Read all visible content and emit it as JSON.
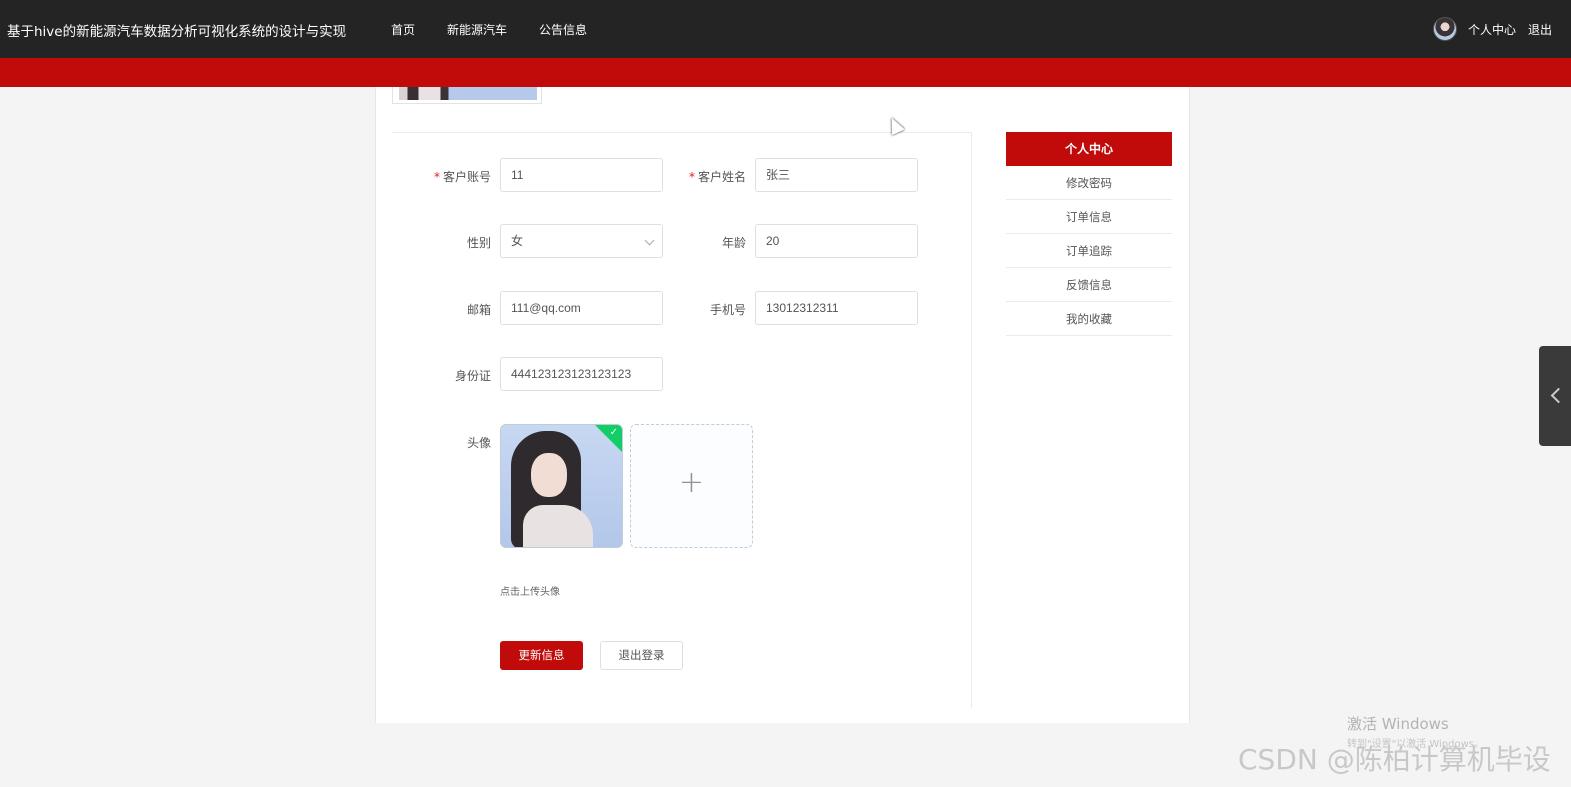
{
  "nav": {
    "site_title": "基于hive的新能源汽车数据分析可视化系统的设计与实现",
    "items": [
      "首页",
      "新能源汽车",
      "公告信息"
    ],
    "user_center": "个人中心",
    "logout": "退出"
  },
  "form": {
    "account": {
      "label": "客户账号",
      "required": "*",
      "value": "11"
    },
    "name": {
      "label": "客户姓名",
      "required": "*",
      "value": "张三"
    },
    "gender": {
      "label": "性别",
      "value": "女"
    },
    "age": {
      "label": "年龄",
      "value": "20"
    },
    "email": {
      "label": "邮箱",
      "value": "111@qq.com"
    },
    "phone": {
      "label": "手机号",
      "value": "13012312311"
    },
    "id_card": {
      "label": "身份证",
      "value": "444123123123123123"
    },
    "avatar": {
      "label": "头像",
      "plus": "+",
      "hint": "点击上传头像"
    },
    "update_button": "更新信息",
    "logout_button": "退出登录"
  },
  "side_menu": {
    "active": "个人中心",
    "items": [
      "修改密码",
      "订单信息",
      "订单追踪",
      "反馈信息",
      "我的收藏"
    ]
  },
  "watermarks": {
    "windows_title": "激活 Windows",
    "windows_sub": "转到\"设置\"以激活 Windows。",
    "csdn": "CSDN @陈柏计算机毕设"
  },
  "colors": {
    "accent": "#c10b0b",
    "topbar": "#242424",
    "success": "#13ce66"
  },
  "icons": {
    "dropdown": "chevron-down-icon",
    "upload": "plus-icon",
    "side_tab": "chevron-left-icon"
  }
}
